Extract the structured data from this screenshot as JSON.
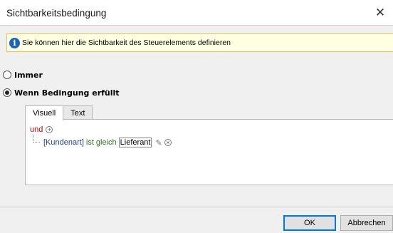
{
  "window": {
    "title": "Sichtbarkeitsbedingung",
    "close_glyph": "✕"
  },
  "info": {
    "text": "Sie können hier die Sichtbarkeit des Steuerelements definieren",
    "icon": "info-icon",
    "icon_glyph": "i"
  },
  "visibility": {
    "options": [
      {
        "label": "Immer",
        "checked": false
      },
      {
        "label": "Wenn Bedingung erfüllt",
        "checked": true
      }
    ]
  },
  "tabs": [
    {
      "label": "Visuell",
      "active": true
    },
    {
      "label": "Text",
      "active": false
    }
  ],
  "condition": {
    "operator": "und",
    "add_glyph": "+",
    "rule": {
      "field": "[Kundenart]",
      "comparison": "ist gleich",
      "value": "Lieferant",
      "edit_glyph": "✎",
      "remove_glyph": "×"
    }
  },
  "buttons": {
    "ok": "OK",
    "cancel": "Abbrechen"
  },
  "colors": {
    "operator_red": "#c00000",
    "field_blue": "#1f3f9f",
    "comparison_green": "#2e7a1e",
    "info_bg": "#ffffe1",
    "info_icon": "#1d63b8"
  }
}
